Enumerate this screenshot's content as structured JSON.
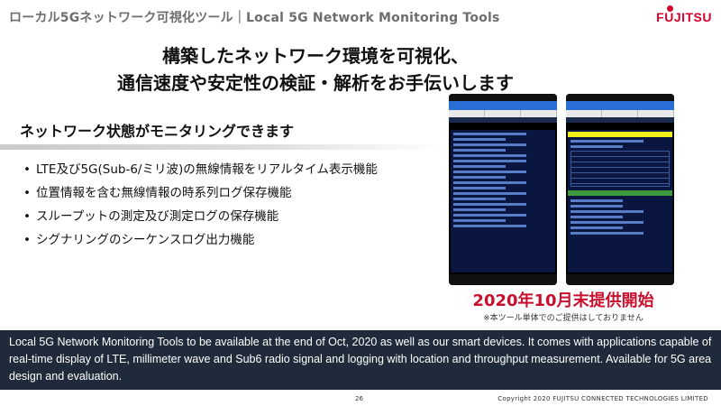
{
  "header": {
    "title": "ローカル5Gネットワーク可視化ツール｜Local 5G Network Monitoring Tools",
    "brand": "FUJITSU"
  },
  "headline": {
    "line1": "構築したネットワーク環境を可視化、",
    "line2": "通信速度や安定性の検証・解析をお手伝いします"
  },
  "section": {
    "subhead": "ネットワーク状態がモニタリングできます",
    "features": [
      "LTE及び5G(Sub-6/ミリ波)の無線情報をリアルタイム表示機能",
      "位置情報を含む無線情報の時系列ログ保存機能",
      "スループットの測定及び測定ログの保存機能",
      "シグナリングのシーケンスログ出力機能"
    ]
  },
  "release": {
    "label": "2020年10月末提供開始",
    "note": "※本ツール単体でのご提供はしておりません"
  },
  "footer": {
    "description": "Local 5G Network Monitoring Tools to be available at the end of Oct, 2020 as well as our smart devices.  It comes with applications capable of real-time display of LTE, millimeter wave and Sub6 radio signal and logging with location and throughput measurement.  Available for 5G area design and evaluation.",
    "page_number": "26",
    "copyright": "Copyright 2020 FUJITSU CONNECTED TECHNOLOGIES LIMITED"
  },
  "colors": {
    "brand_red": "#d3002c",
    "release_red": "#c8102e",
    "footer_band": "#1f2a3a"
  }
}
